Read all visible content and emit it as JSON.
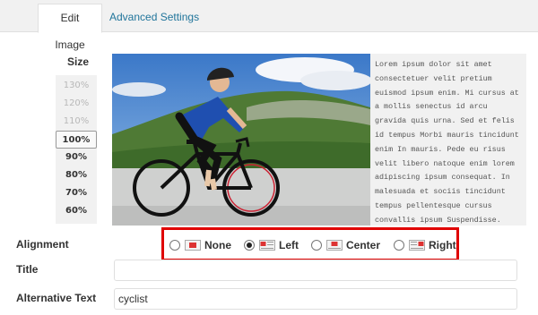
{
  "tabs": {
    "edit_image": "Edit Image",
    "advanced_settings": "Advanced Settings"
  },
  "size": {
    "title": "Size",
    "options": [
      {
        "label": "130%",
        "state": "disabled"
      },
      {
        "label": "120%",
        "state": "disabled"
      },
      {
        "label": "110%",
        "state": "disabled"
      },
      {
        "label": "100%",
        "state": "selected"
      },
      {
        "label": "90%",
        "state": "enabled"
      },
      {
        "label": "80%",
        "state": "enabled"
      },
      {
        "label": "70%",
        "state": "enabled"
      },
      {
        "label": "60%",
        "state": "enabled"
      }
    ]
  },
  "preview": {
    "text": "Lorem ipsum dolor sit amet consectetuer velit pretium euismod ipsum enim. Mi cursus at a mollis senectus id arcu gravida quis urna. Sed et felis id tempus Morbi mauris tincidunt enim In mauris. Pede eu risus velit libero natoque enim lorem adipiscing ipsum consequat. In malesuada et sociis tincidunt tempus pellentesque cursus convallis ipsum Suspendisse. Risus In ac quis ut Nunc convallis"
  },
  "alignment": {
    "label": "Alignment",
    "options": [
      {
        "label": "None",
        "checked": false
      },
      {
        "label": "Left",
        "checked": true
      },
      {
        "label": "Center",
        "checked": false
      },
      {
        "label": "Right",
        "checked": false
      }
    ],
    "highlight_color": "#e00000"
  },
  "title_field": {
    "label": "Title",
    "value": ""
  },
  "alt_text_field": {
    "label": "Alternative Text",
    "value": "cyclist"
  },
  "colors": {
    "link": "#21759b",
    "tab_bar": "#f1f1f1"
  }
}
